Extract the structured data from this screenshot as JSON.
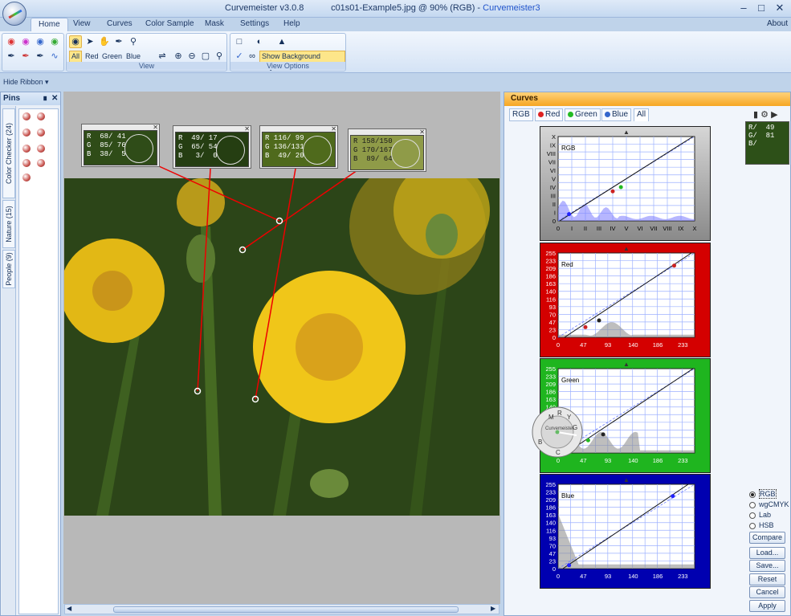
{
  "window": {
    "app_title": "Curvemeister v3.0.8",
    "doc_title": "c01s01-Example5.jpg @ 90% (RGB) -",
    "brand": "Curvemeister3",
    "about": "About"
  },
  "ribbon": {
    "tabs": [
      "Home",
      "View",
      "Curves",
      "Color Sample",
      "Mask",
      "Settings",
      "Help"
    ],
    "active_tab": "Home",
    "channels": [
      "All",
      "Red",
      "Green",
      "Blue"
    ],
    "active_channel": "All",
    "group_view": "View",
    "group_view_options": "View Options",
    "show_bg": "Show Background Layers",
    "hide_ribbon": "Hide Ribbon"
  },
  "pins": {
    "title": "Pins",
    "tabs": [
      "Color Checker (24)",
      "Nature (15)",
      "People (9)"
    ]
  },
  "samples": [
    {
      "r": "R  68/ 41",
      "g": "G  85/ 76",
      "b": "B  38/  5",
      "bg": "#2f4c18"
    },
    {
      "r": "R  49/ 17",
      "g": "G  65/ 54",
      "b": "B   3/  0",
      "bg": "#253e12"
    },
    {
      "r": "R 116/ 99",
      "g": "G 136/131",
      "b": "B  49/ 20",
      "bg": "#4f6a1c"
    },
    {
      "r": "R 158/150",
      "g": "G 170/167",
      "b": "B  89/ 64",
      "bg": "#8f9b48"
    }
  ],
  "curves": {
    "title": "Curves",
    "tabs": [
      "RGB",
      "Red",
      "Green",
      "Blue",
      "All"
    ],
    "active_tab": "All",
    "rgb_panel_label": "RGB",
    "roman_y": [
      "X",
      "IX",
      "VIII",
      "VII",
      "VI",
      "V",
      "IV",
      "III",
      "II",
      "I",
      "0"
    ],
    "roman_x": [
      "0",
      "I",
      "II",
      "III",
      "IV",
      "V",
      "VI",
      "VII",
      "VIII",
      "IX",
      "X"
    ],
    "y_ticks": [
      "255",
      "233",
      "209",
      "186",
      "163",
      "140",
      "116",
      "93",
      "70",
      "47",
      "23",
      "0"
    ],
    "x_ticks": [
      "0",
      "47",
      "93",
      "140",
      "186",
      "233"
    ],
    "panels": [
      {
        "label": "Red",
        "bg": "#d40000"
      },
      {
        "label": "Green",
        "bg": "#1fb51f"
      },
      {
        "label": "Blue",
        "bg": "#0000b0"
      }
    ],
    "mini_sample": "R/  49\nG/  81\nB/",
    "wheel_letters": [
      "M",
      "R",
      "Y",
      "G",
      "C",
      "B"
    ],
    "wheel_label": "Curvemeister",
    "modes": [
      "RGB",
      "wgCMYK",
      "Lab",
      "HSB"
    ],
    "active_mode": "RGB",
    "buttons": [
      "Compare",
      "Load...",
      "Save...",
      "Reset",
      "Cancel",
      "Apply"
    ]
  }
}
